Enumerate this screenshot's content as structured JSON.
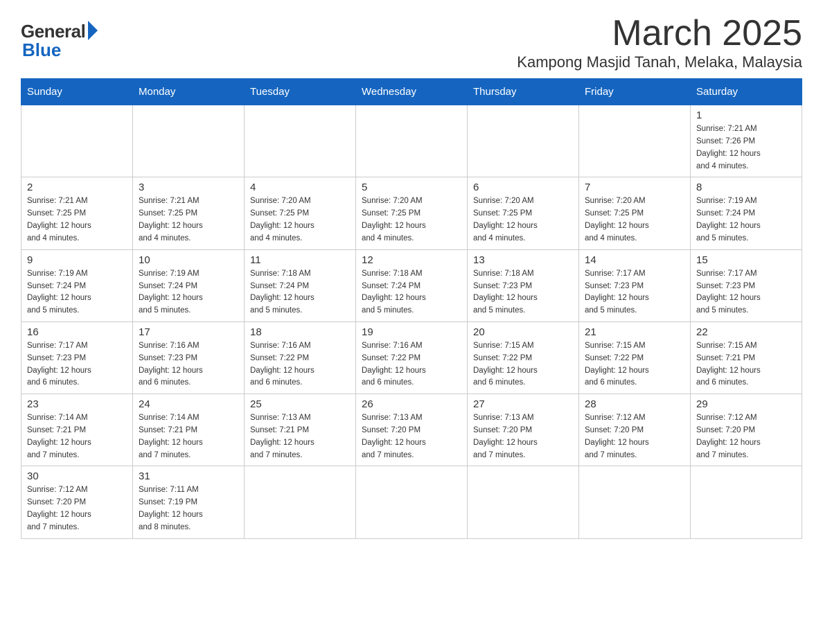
{
  "logo": {
    "general": "General",
    "blue": "Blue"
  },
  "title": {
    "month": "March 2025",
    "location": "Kampong Masjid Tanah, Melaka, Malaysia"
  },
  "weekdays": [
    "Sunday",
    "Monday",
    "Tuesday",
    "Wednesday",
    "Thursday",
    "Friday",
    "Saturday"
  ],
  "weeks": [
    [
      {
        "day": "",
        "info": ""
      },
      {
        "day": "",
        "info": ""
      },
      {
        "day": "",
        "info": ""
      },
      {
        "day": "",
        "info": ""
      },
      {
        "day": "",
        "info": ""
      },
      {
        "day": "",
        "info": ""
      },
      {
        "day": "1",
        "info": "Sunrise: 7:21 AM\nSunset: 7:26 PM\nDaylight: 12 hours\nand 4 minutes."
      }
    ],
    [
      {
        "day": "2",
        "info": "Sunrise: 7:21 AM\nSunset: 7:25 PM\nDaylight: 12 hours\nand 4 minutes."
      },
      {
        "day": "3",
        "info": "Sunrise: 7:21 AM\nSunset: 7:25 PM\nDaylight: 12 hours\nand 4 minutes."
      },
      {
        "day": "4",
        "info": "Sunrise: 7:20 AM\nSunset: 7:25 PM\nDaylight: 12 hours\nand 4 minutes."
      },
      {
        "day": "5",
        "info": "Sunrise: 7:20 AM\nSunset: 7:25 PM\nDaylight: 12 hours\nand 4 minutes."
      },
      {
        "day": "6",
        "info": "Sunrise: 7:20 AM\nSunset: 7:25 PM\nDaylight: 12 hours\nand 4 minutes."
      },
      {
        "day": "7",
        "info": "Sunrise: 7:20 AM\nSunset: 7:25 PM\nDaylight: 12 hours\nand 4 minutes."
      },
      {
        "day": "8",
        "info": "Sunrise: 7:19 AM\nSunset: 7:24 PM\nDaylight: 12 hours\nand 5 minutes."
      }
    ],
    [
      {
        "day": "9",
        "info": "Sunrise: 7:19 AM\nSunset: 7:24 PM\nDaylight: 12 hours\nand 5 minutes."
      },
      {
        "day": "10",
        "info": "Sunrise: 7:19 AM\nSunset: 7:24 PM\nDaylight: 12 hours\nand 5 minutes."
      },
      {
        "day": "11",
        "info": "Sunrise: 7:18 AM\nSunset: 7:24 PM\nDaylight: 12 hours\nand 5 minutes."
      },
      {
        "day": "12",
        "info": "Sunrise: 7:18 AM\nSunset: 7:24 PM\nDaylight: 12 hours\nand 5 minutes."
      },
      {
        "day": "13",
        "info": "Sunrise: 7:18 AM\nSunset: 7:23 PM\nDaylight: 12 hours\nand 5 minutes."
      },
      {
        "day": "14",
        "info": "Sunrise: 7:17 AM\nSunset: 7:23 PM\nDaylight: 12 hours\nand 5 minutes."
      },
      {
        "day": "15",
        "info": "Sunrise: 7:17 AM\nSunset: 7:23 PM\nDaylight: 12 hours\nand 5 minutes."
      }
    ],
    [
      {
        "day": "16",
        "info": "Sunrise: 7:17 AM\nSunset: 7:23 PM\nDaylight: 12 hours\nand 6 minutes."
      },
      {
        "day": "17",
        "info": "Sunrise: 7:16 AM\nSunset: 7:23 PM\nDaylight: 12 hours\nand 6 minutes."
      },
      {
        "day": "18",
        "info": "Sunrise: 7:16 AM\nSunset: 7:22 PM\nDaylight: 12 hours\nand 6 minutes."
      },
      {
        "day": "19",
        "info": "Sunrise: 7:16 AM\nSunset: 7:22 PM\nDaylight: 12 hours\nand 6 minutes."
      },
      {
        "day": "20",
        "info": "Sunrise: 7:15 AM\nSunset: 7:22 PM\nDaylight: 12 hours\nand 6 minutes."
      },
      {
        "day": "21",
        "info": "Sunrise: 7:15 AM\nSunset: 7:22 PM\nDaylight: 12 hours\nand 6 minutes."
      },
      {
        "day": "22",
        "info": "Sunrise: 7:15 AM\nSunset: 7:21 PM\nDaylight: 12 hours\nand 6 minutes."
      }
    ],
    [
      {
        "day": "23",
        "info": "Sunrise: 7:14 AM\nSunset: 7:21 PM\nDaylight: 12 hours\nand 7 minutes."
      },
      {
        "day": "24",
        "info": "Sunrise: 7:14 AM\nSunset: 7:21 PM\nDaylight: 12 hours\nand 7 minutes."
      },
      {
        "day": "25",
        "info": "Sunrise: 7:13 AM\nSunset: 7:21 PM\nDaylight: 12 hours\nand 7 minutes."
      },
      {
        "day": "26",
        "info": "Sunrise: 7:13 AM\nSunset: 7:20 PM\nDaylight: 12 hours\nand 7 minutes."
      },
      {
        "day": "27",
        "info": "Sunrise: 7:13 AM\nSunset: 7:20 PM\nDaylight: 12 hours\nand 7 minutes."
      },
      {
        "day": "28",
        "info": "Sunrise: 7:12 AM\nSunset: 7:20 PM\nDaylight: 12 hours\nand 7 minutes."
      },
      {
        "day": "29",
        "info": "Sunrise: 7:12 AM\nSunset: 7:20 PM\nDaylight: 12 hours\nand 7 minutes."
      }
    ],
    [
      {
        "day": "30",
        "info": "Sunrise: 7:12 AM\nSunset: 7:20 PM\nDaylight: 12 hours\nand 7 minutes."
      },
      {
        "day": "31",
        "info": "Sunrise: 7:11 AM\nSunset: 7:19 PM\nDaylight: 12 hours\nand 8 minutes."
      },
      {
        "day": "",
        "info": ""
      },
      {
        "day": "",
        "info": ""
      },
      {
        "day": "",
        "info": ""
      },
      {
        "day": "",
        "info": ""
      },
      {
        "day": "",
        "info": ""
      }
    ]
  ]
}
